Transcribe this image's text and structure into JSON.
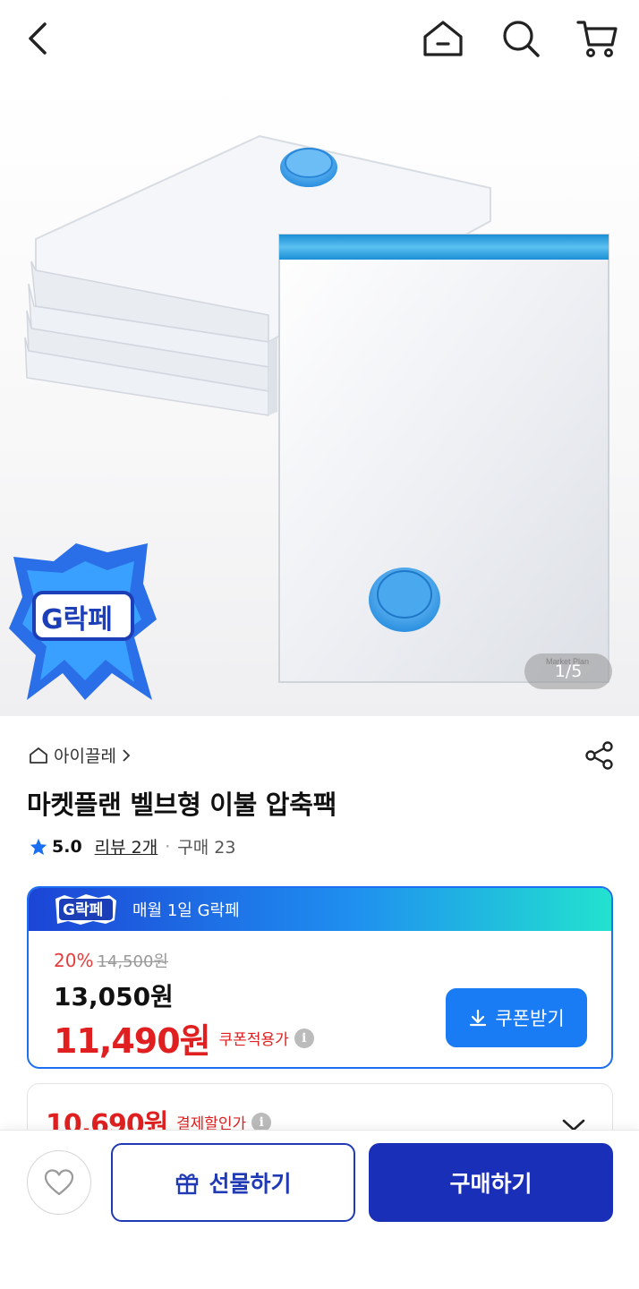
{
  "nav": {
    "icons": [
      "back-arrow-icon",
      "home-icon",
      "search-icon",
      "cart-icon"
    ]
  },
  "hero": {
    "page_indicator": "1/5",
    "promo_badge_text": "G락페",
    "product_image": "vacuum-storage-bags-image"
  },
  "product": {
    "breadcrumb": "아이끌레",
    "title": "마켓플랜 벨브형 이불 압축팩",
    "rating": "5.0",
    "reviews": "리뷰 2개",
    "purchases": "구매 23"
  },
  "deal": {
    "badge_text": "G락페",
    "banner_text": "매월 1일 G락페",
    "discount_rate": "20%",
    "original_price": "14,500원",
    "sale_price": "13,050원",
    "coupon_price": "11,490원",
    "coupon_label": "쿠폰적용가",
    "coupon_button": "쿠폰받기"
  },
  "deal2": {
    "price": "10,690원",
    "label": "결제할인가"
  },
  "bottom": {
    "gift_label": "선물하기",
    "buy_label": "구매하기"
  },
  "colors": {
    "primary": "#1a2fb8",
    "accent_blue": "#1a7cf5",
    "sale_red": "#e02020",
    "banner_gradient_start": "#1c45d6",
    "banner_gradient_end": "#22e2cf"
  }
}
